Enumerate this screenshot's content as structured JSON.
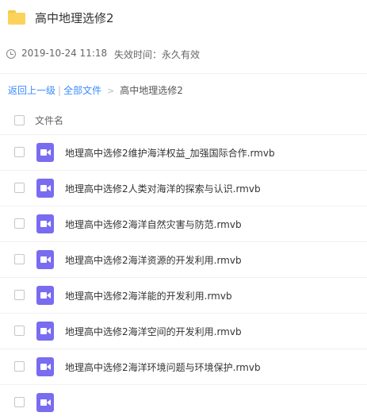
{
  "header": {
    "title": "高中地理选修2"
  },
  "meta": {
    "datetime": "2019-10-24 11:18",
    "expiry": "失效时间：永久有效"
  },
  "breadcrumb": {
    "back": "返回上一级",
    "separator": "|",
    "all_files": "全部文件",
    "arrow": ">",
    "current": "高中地理选修2"
  },
  "list": {
    "column_name": "文件名",
    "files": [
      {
        "name": "地理高中选修2维护海洋权益_加强国际合作.rmvb"
      },
      {
        "name": "地理高中选修2人类对海洋的探索与认识.rmvb"
      },
      {
        "name": "地理高中选修2海洋自然灾害与防范.rmvb"
      },
      {
        "name": "地理高中选修2海洋资源的开发利用.rmvb"
      },
      {
        "name": "地理高中选修2海洋能的开发利用.rmvb"
      },
      {
        "name": "地理高中选修2海洋空间的开发利用.rmvb"
      },
      {
        "name": "地理高中选修2海洋环境问题与环境保护.rmvb"
      },
      {
        "name": ""
      }
    ]
  },
  "colors": {
    "accent": "#3b8cff",
    "folder": "#fbd35a",
    "video_icon": "#7a6cf0"
  },
  "icons": {
    "folder": "folder-icon",
    "clock": "clock-icon",
    "video": "video-file-icon"
  }
}
